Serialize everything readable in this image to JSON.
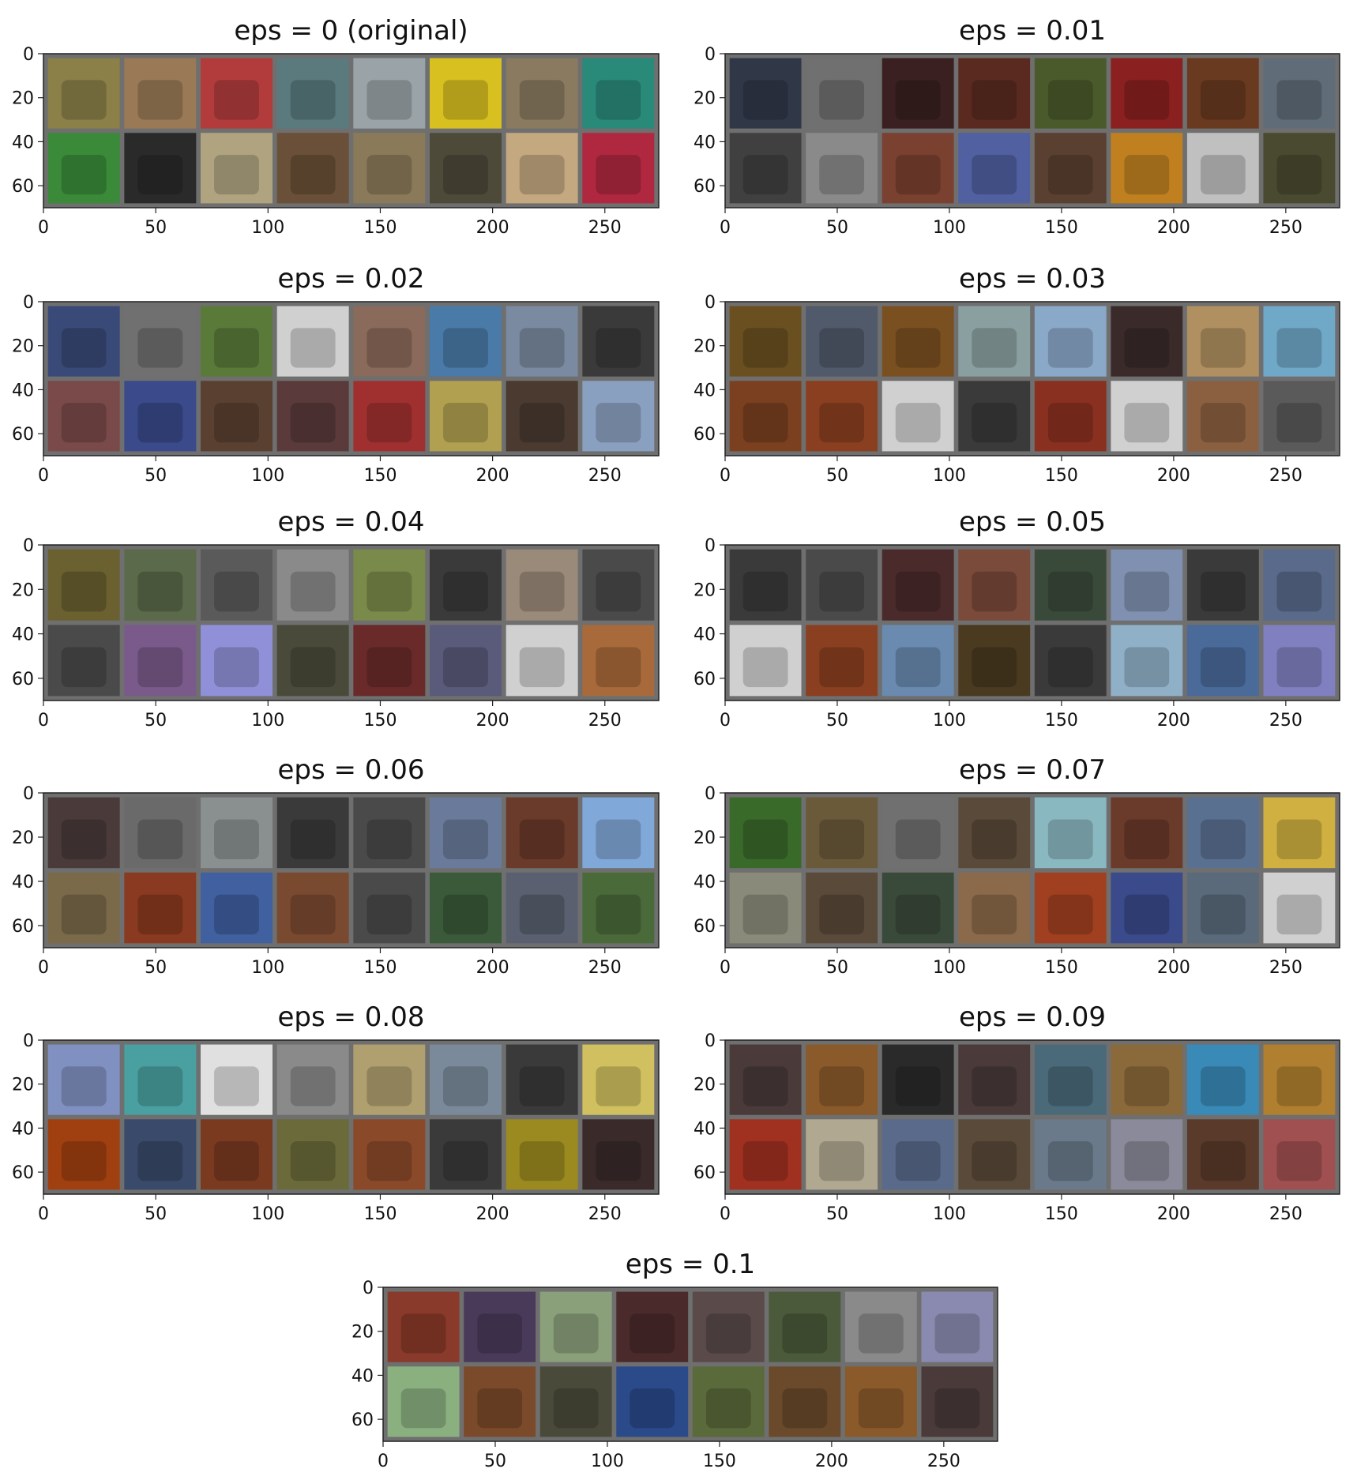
{
  "chart_data": [
    {
      "type": "image-grid",
      "title": "eps = 0 (original)",
      "xlim": [
        0,
        274
      ],
      "ylim": [
        0,
        70
      ],
      "xticks": [
        0,
        50,
        100,
        150,
        200,
        250
      ],
      "yticks": [
        0,
        20,
        40,
        60
      ],
      "grid": false,
      "tile_colors": [
        "#8a8048",
        "#9a7a56",
        "#b23c3c",
        "#5a7a7e",
        "#9aa4a8",
        "#d8c020",
        "#8a7a60",
        "#2a8a7a",
        "#3a8a3a",
        "#2a2a2a",
        "#b0a480",
        "#6a5038",
        "#8a7a5a",
        "#4e4a3a",
        "#c4a880",
        "#b02840"
      ]
    },
    {
      "type": "image-grid",
      "title": "eps = 0.01",
      "xlim": [
        0,
        274
      ],
      "ylim": [
        0,
        70
      ],
      "xticks": [
        0,
        50,
        100,
        150,
        200,
        250
      ],
      "yticks": [
        0,
        20,
        40,
        60
      ],
      "grid": false,
      "tile_colors": [
        "#303848",
        "#707070",
        "#3a2020",
        "#5a2a20",
        "#4a5a2a",
        "#8a2020",
        "#6a3a20",
        "#606c78",
        "#404040",
        "#8a8a8a",
        "#7a4030",
        "#5060a0",
        "#5a4030",
        "#c08020",
        "#c0c0c0",
        "#4a4a30"
      ]
    },
    {
      "type": "image-grid",
      "title": "eps = 0.02",
      "xlim": [
        0,
        274
      ],
      "ylim": [
        0,
        70
      ],
      "xticks": [
        0,
        50,
        100,
        150,
        200,
        250
      ],
      "yticks": [
        0,
        20,
        40,
        60
      ],
      "grid": false,
      "tile_colors": [
        "#3a4a78",
        "#707070",
        "#5a7a3a",
        "#d0d0d0",
        "#8a6a5a",
        "#4a7aa8",
        "#7a8aa0",
        "#3a3a3a",
        "#7a4a4a",
        "#3a4a8a",
        "#5a4030",
        "#5a3a3a",
        "#a03030",
        "#b0a050",
        "#4a3a30",
        "#8aa0c0"
      ]
    },
    {
      "type": "image-grid",
      "title": "eps = 0.03",
      "xlim": [
        0,
        274
      ],
      "ylim": [
        0,
        70
      ],
      "xticks": [
        0,
        50,
        100,
        150,
        200,
        250
      ],
      "yticks": [
        0,
        20,
        40,
        60
      ],
      "grid": false,
      "tile_colors": [
        "#6a5020",
        "#505a6a",
        "#7a5020",
        "#8aa0a0",
        "#8aa8c8",
        "#3a2a2a",
        "#b09060",
        "#70a8c8",
        "#7a4020",
        "#8a4020",
        "#d0d0d0",
        "#3a3a3a",
        "#8a3020",
        "#d0d0d0",
        "#8a6040",
        "#5a5a5a"
      ]
    },
    {
      "type": "image-grid",
      "title": "eps = 0.04",
      "xlim": [
        0,
        274
      ],
      "ylim": [
        0,
        70
      ],
      "xticks": [
        0,
        50,
        100,
        150,
        200,
        250
      ],
      "yticks": [
        0,
        20,
        40,
        60
      ],
      "grid": false,
      "tile_colors": [
        "#6a6030",
        "#5a6a4a",
        "#5a5a5a",
        "#8a8a8a",
        "#7a8a4a",
        "#3a3a3a",
        "#9a8a7a",
        "#4a4a4a",
        "#4a4a4a",
        "#7a5a8a",
        "#9090d8",
        "#4a4a3a",
        "#6a2a2a",
        "#5a5a7a",
        "#d0d0d0",
        "#a86a3a"
      ]
    },
    {
      "type": "image-grid",
      "title": "eps = 0.05",
      "xlim": [
        0,
        274
      ],
      "ylim": [
        0,
        70
      ],
      "xticks": [
        0,
        50,
        100,
        150,
        200,
        250
      ],
      "yticks": [
        0,
        20,
        40,
        60
      ],
      "grid": false,
      "tile_colors": [
        "#3a3a3a",
        "#4a4a4a",
        "#4a2a2a",
        "#7a4a3a",
        "#3a4a3a",
        "#8090b0",
        "#3a3a3a",
        "#5a6a8a",
        "#d0d0d0",
        "#8a4020",
        "#6a8ab0",
        "#4a3a20",
        "#3a3a3a",
        "#90b0c8",
        "#4a6a9a",
        "#8080c0"
      ]
    },
    {
      "type": "image-grid",
      "title": "eps = 0.06",
      "xlim": [
        0,
        274
      ],
      "ylim": [
        0,
        70
      ],
      "xticks": [
        0,
        50,
        100,
        150,
        200,
        250
      ],
      "yticks": [
        0,
        20,
        40,
        60
      ],
      "grid": false,
      "tile_colors": [
        "#4a3a3a",
        "#6a6a6a",
        "#8a9090",
        "#3a3a3a",
        "#4a4a4a",
        "#6a7a9a",
        "#6a3a2a",
        "#80a8d8",
        "#7a6a4a",
        "#8a3a20",
        "#4060a0",
        "#7a4a30",
        "#4a4a4a",
        "#3a5a3a",
        "#5a6070",
        "#4a6a3a"
      ]
    },
    {
      "type": "image-grid",
      "title": "eps = 0.07",
      "xlim": [
        0,
        274
      ],
      "ylim": [
        0,
        70
      ],
      "xticks": [
        0,
        50,
        100,
        150,
        200,
        250
      ],
      "yticks": [
        0,
        20,
        40,
        60
      ],
      "grid": false,
      "tile_colors": [
        "#3a6a2a",
        "#6a5a3a",
        "#707070",
        "#5a4a3a",
        "#8ab8c0",
        "#6a3a2a",
        "#5a7090",
        "#d0b040",
        "#8a8a7a",
        "#5a4a3a",
        "#3a4a3a",
        "#8a6a4a",
        "#a04020",
        "#3a4a8a",
        "#5a6a7a",
        "#d0d0d0"
      ]
    },
    {
      "type": "image-grid",
      "title": "eps = 0.08",
      "xlim": [
        0,
        274
      ],
      "ylim": [
        0,
        70
      ],
      "xticks": [
        0,
        50,
        100,
        150,
        200,
        250
      ],
      "yticks": [
        0,
        20,
        40,
        60
      ],
      "grid": false,
      "tile_colors": [
        "#8090c0",
        "#4aa0a0",
        "#e0e0e0",
        "#8a8a8a",
        "#b0a070",
        "#7a8a9a",
        "#3a3a3a",
        "#d0c060",
        "#a04010",
        "#3a4a6a",
        "#7a3a20",
        "#6a6a3a",
        "#8a4a2a",
        "#3a3a3a",
        "#9a8a20",
        "#3a2a2a"
      ]
    },
    {
      "type": "image-grid",
      "title": "eps = 0.09",
      "xlim": [
        0,
        274
      ],
      "ylim": [
        0,
        70
      ],
      "xticks": [
        0,
        50,
        100,
        150,
        200,
        250
      ],
      "yticks": [
        0,
        20,
        40,
        60
      ],
      "grid": false,
      "tile_colors": [
        "#4a3a3a",
        "#8a5a2a",
        "#2a2a2a",
        "#4a3a3a",
        "#4a6a7a",
        "#8a6a3a",
        "#3a8ab8",
        "#b08030",
        "#a03020",
        "#b0a890",
        "#5a6a8a",
        "#5a4a3a",
        "#6a7a8a",
        "#8a8a9a",
        "#5a3a2a",
        "#a05050"
      ]
    },
    {
      "type": "image-grid",
      "title": "eps = 0.1",
      "xlim": [
        0,
        274
      ],
      "ylim": [
        0,
        70
      ],
      "xticks": [
        0,
        50,
        100,
        150,
        200,
        250
      ],
      "yticks": [
        0,
        20,
        40,
        60
      ],
      "grid": false,
      "tile_colors": [
        "#8a3a2a",
        "#4a3a5a",
        "#8aa07a",
        "#4a2a2a",
        "#5a4a4a",
        "#4a5a3a",
        "#8a8a8a",
        "#8a8ab0",
        "#8ab080",
        "#7a4a2a",
        "#4a4a3a",
        "#2a4a8a",
        "#5a6a3a",
        "#6a4a2a",
        "#8a5a2a",
        "#4a3a3a"
      ]
    }
  ]
}
